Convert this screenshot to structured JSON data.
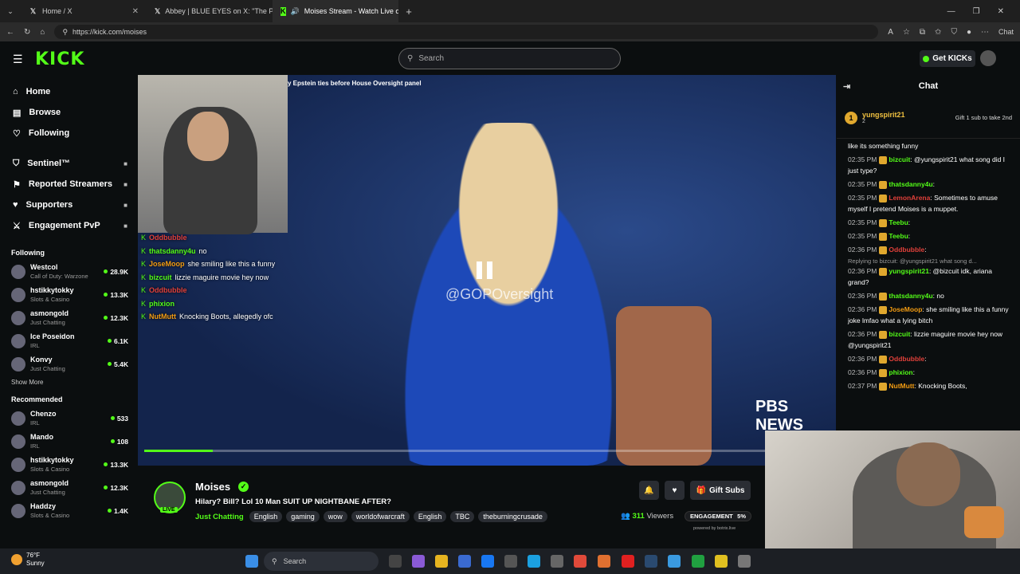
{
  "browser": {
    "tabs": [
      {
        "title": "Home / X",
        "icon": "x-logo-icon"
      },
      {
        "title": "Abbey | BLUE EYES on X: \"The Pizz",
        "icon": "x-logo-icon"
      },
      {
        "title": "Moises Stream - Watch Live o",
        "icon": "kick-logo-icon"
      }
    ],
    "url": "https://kick.com/moises",
    "chat_button": "Chat"
  },
  "header": {
    "logo": "KICK",
    "search_placeholder": "Search",
    "get_kicks": "Get KICKs"
  },
  "sidebar": {
    "nav": [
      {
        "label": "Home",
        "icon": "home-icon"
      },
      {
        "label": "Browse",
        "icon": "browse-icon"
      },
      {
        "label": "Following",
        "icon": "heart-icon"
      }
    ],
    "mod_nav": [
      {
        "label": "Sentinel™",
        "icon": "shield-icon"
      },
      {
        "label": "Reported Streamers",
        "icon": "flag-icon"
      },
      {
        "label": "Supporters",
        "icon": "heart-icon"
      },
      {
        "label": "Engagement PvP",
        "icon": "swords-icon"
      }
    ],
    "following_title": "Following",
    "following": [
      {
        "name": "Westcol",
        "category": "Call of Duty: Warzone",
        "viewers": "28.9K"
      },
      {
        "name": "hstikkytokky",
        "category": "Slots & Casino",
        "viewers": "13.3K"
      },
      {
        "name": "asmongold",
        "category": "Just Chatting",
        "viewers": "12.3K"
      },
      {
        "name": "Ice Poseidon",
        "category": "IRL",
        "viewers": "6.1K"
      },
      {
        "name": "Konvy",
        "category": "Just Chatting",
        "viewers": "5.4K"
      }
    ],
    "show_more": "Show More",
    "recommended_title": "Recommended",
    "recommended": [
      {
        "name": "Chenzo",
        "category": "IRL",
        "viewers": "533"
      },
      {
        "name": "Mando",
        "category": "IRL",
        "viewers": "108"
      },
      {
        "name": "hstikkytokky",
        "category": "Slots & Casino",
        "viewers": "13.3K"
      },
      {
        "name": "asmongold",
        "category": "Just Chatting",
        "viewers": "12.3K"
      },
      {
        "name": "Haddzy",
        "category": "Slots & Casino",
        "viewers": "1.4K"
      }
    ]
  },
  "player": {
    "ticker": "y Epstein ties before House Oversight panel",
    "watermark": "@GOPOversight",
    "network": "PBS NEWS",
    "progress": 0.1,
    "overlay_chat": [
      {
        "user": "Oddbubble",
        "text": "",
        "color": "#e0403a"
      },
      {
        "user": "thatsdanny4u",
        "text": "no",
        "color": "#53fc18"
      },
      {
        "user": "JoseMoop",
        "text": "she smiling like this a funny",
        "color": "#f39c12"
      },
      {
        "user": "bizcuit",
        "text": "lizzie maguire movie hey now",
        "color": "#53fc18"
      },
      {
        "user": "Oddbubble",
        "text": "",
        "color": "#e0403a"
      },
      {
        "user": "phixion",
        "text": "",
        "color": "#53fc18"
      },
      {
        "user": "NutMutt",
        "text": "Knocking Boots, allegedly ofc",
        "color": "#f39c12"
      }
    ]
  },
  "channel": {
    "name": "Moises",
    "live_badge": "LIVE",
    "title": "Hilary? Bill? Lol 10 Man SUIT UP NIGHTBANE AFTER?",
    "category": "Just Chatting",
    "tags": [
      "English",
      "gaming",
      "wow",
      "worldofwarcraft",
      "English",
      "TBC",
      "theburningcrusade"
    ],
    "gift_subs": "Gift Subs",
    "viewers_count": "311",
    "viewers_label": "Viewers",
    "engagement_label": "ENGAGEMENT",
    "engagement_value": "5%",
    "powered_by": "powered by botrix.live"
  },
  "chat": {
    "title": "Chat",
    "pinned_user": "yungspirit21",
    "pinned_count": "2",
    "pinned_rank": "1",
    "pinned_gift": "Gift 1 sub to take 2nd",
    "messages": [
      {
        "time": "",
        "user": "",
        "text": "like its something funny",
        "color": "#53fc18"
      },
      {
        "time": "02:35 PM",
        "user": "bizcuit",
        "text": "@yungspirit21 what song did I just type?",
        "color": "#53fc18"
      },
      {
        "time": "02:35 PM",
        "user": "thatsdanny4u",
        "text": "",
        "color": "#53fc18"
      },
      {
        "time": "02:35 PM",
        "user": "LemonArena",
        "text": "Sometimes to amuse myself I pretend Moises is a muppet.",
        "color": "#e0403a"
      },
      {
        "time": "02:35 PM",
        "user": "Teebu",
        "text": "",
        "color": "#53fc18"
      },
      {
        "time": "02:35 PM",
        "user": "Teebu",
        "text": "",
        "color": "#53fc18"
      },
      {
        "time": "02:36 PM",
        "user": "Oddbubble",
        "text": "",
        "color": "#e0403a"
      },
      {
        "time": "02:36 PM",
        "user": "yungspirit21",
        "text": "@bizcuit idk, ariana grand?",
        "color": "#53fc18",
        "reply": "Replying to bizcuit: @yungspirit21 what song d..."
      },
      {
        "time": "02:36 PM",
        "user": "thatsdanny4u",
        "text": "no",
        "color": "#53fc18"
      },
      {
        "time": "02:36 PM",
        "user": "JoseMoop",
        "text": "she smiling like this a funny joke lmfao what a lying bitch",
        "color": "#f39c12"
      },
      {
        "time": "02:36 PM",
        "user": "bizcuit",
        "text": "lizzie maguire movie hey now @yungspirit21",
        "color": "#53fc18"
      },
      {
        "time": "02:36 PM",
        "user": "Oddbubble",
        "text": "",
        "color": "#e0403a"
      },
      {
        "time": "02:36 PM",
        "user": "phixion",
        "text": "",
        "color": "#53fc18"
      },
      {
        "time": "02:37 PM",
        "user": "NutMutt",
        "text": "Knocking Boots,",
        "color": "#f39c12"
      }
    ]
  },
  "taskbar": {
    "temp": "76°F",
    "condition": "Sunny",
    "search": "Search"
  }
}
